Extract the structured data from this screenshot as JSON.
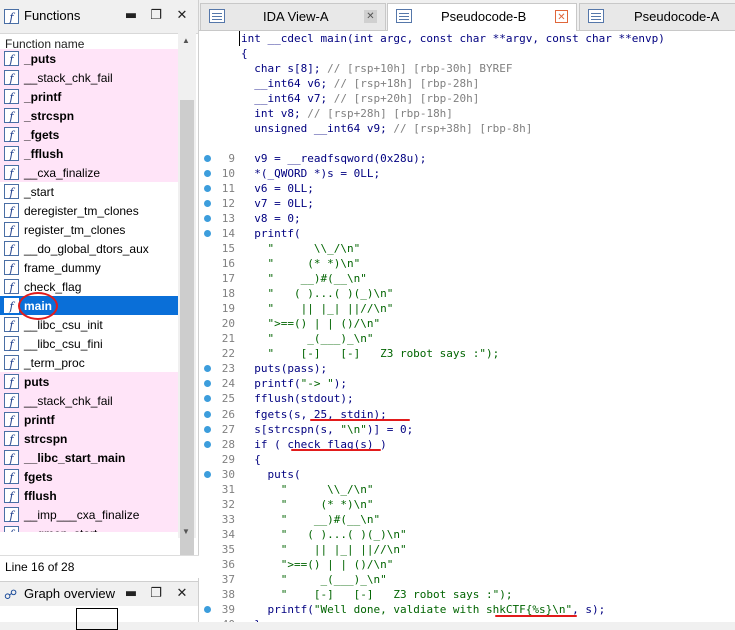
{
  "functions_panel": {
    "title": "Functions",
    "column_header": "Function name",
    "status": "Line 16 of 28",
    "items": [
      {
        "name": "_puts",
        "style": "pink-bold"
      },
      {
        "name": "__stack_chk_fail",
        "style": "pink"
      },
      {
        "name": "_printf",
        "style": "pink-bold"
      },
      {
        "name": "_strcspn",
        "style": "pink-bold"
      },
      {
        "name": "_fgets",
        "style": "pink-bold"
      },
      {
        "name": "_fflush",
        "style": "pink-bold"
      },
      {
        "name": "__cxa_finalize",
        "style": "pink"
      },
      {
        "name": "_start",
        "style": "white"
      },
      {
        "name": "deregister_tm_clones",
        "style": "white"
      },
      {
        "name": "register_tm_clones",
        "style": "white"
      },
      {
        "name": "__do_global_dtors_aux",
        "style": "white"
      },
      {
        "name": "frame_dummy",
        "style": "white"
      },
      {
        "name": "check_flag",
        "style": "white"
      },
      {
        "name": "main",
        "style": "selected"
      },
      {
        "name": "__libc_csu_init",
        "style": "white"
      },
      {
        "name": "__libc_csu_fini",
        "style": "white"
      },
      {
        "name": "_term_proc",
        "style": "white"
      },
      {
        "name": "puts",
        "style": "pink-bold"
      },
      {
        "name": "__stack_chk_fail",
        "style": "pink"
      },
      {
        "name": "printf",
        "style": "pink-bold"
      },
      {
        "name": "strcspn",
        "style": "pink-bold"
      },
      {
        "name": "__libc_start_main",
        "style": "pink-bold"
      },
      {
        "name": "fgets",
        "style": "pink-bold"
      },
      {
        "name": "fflush",
        "style": "pink-bold"
      },
      {
        "name": "__imp___cxa_finalize",
        "style": "pink"
      },
      {
        "name": "__gmon_start__",
        "style": "pink"
      }
    ]
  },
  "graph_panel": {
    "title": "Graph overview"
  },
  "tabs": [
    {
      "label": "IDA View-A",
      "active": false,
      "close": "gray"
    },
    {
      "label": "Pseudocode-B",
      "active": true,
      "close": "red"
    },
    {
      "label": "Pseudocode-A",
      "active": false,
      "close": "none"
    }
  ],
  "code_lines": [
    {
      "num": "",
      "dot": false,
      "segments": [
        [
          "int __cdecl main(int argc, const char **argv, const char **envp)",
          ""
        ]
      ]
    },
    {
      "num": "",
      "dot": false,
      "segments": [
        [
          "{",
          ""
        ]
      ]
    },
    {
      "num": "",
      "dot": false,
      "segments": [
        [
          "  char s[8]; ",
          ""
        ],
        [
          "// [rsp+10h] [rbp-30h] BYREF",
          "cm"
        ]
      ]
    },
    {
      "num": "",
      "dot": false,
      "segments": [
        [
          "  __int64 v6; ",
          ""
        ],
        [
          "// [rsp+18h] [rbp-28h]",
          "cm"
        ]
      ]
    },
    {
      "num": "",
      "dot": false,
      "segments": [
        [
          "  __int64 v7; ",
          ""
        ],
        [
          "// [rsp+20h] [rbp-20h]",
          "cm"
        ]
      ]
    },
    {
      "num": "",
      "dot": false,
      "segments": [
        [
          "  int v8; ",
          ""
        ],
        [
          "// [rsp+28h] [rbp-18h]",
          "cm"
        ]
      ]
    },
    {
      "num": "",
      "dot": false,
      "segments": [
        [
          "  unsigned __int64 v9; ",
          ""
        ],
        [
          "// [rsp+38h] [rbp-8h]",
          "cm"
        ]
      ]
    },
    {
      "num": "",
      "dot": false,
      "segments": [
        [
          "",
          ""
        ]
      ]
    },
    {
      "num": "9",
      "dot": true,
      "segments": [
        [
          "  v9 = __readfsqword(0x28u);",
          ""
        ]
      ]
    },
    {
      "num": "10",
      "dot": true,
      "segments": [
        [
          "  *(_QWORD *)s = 0LL;",
          ""
        ]
      ]
    },
    {
      "num": "11",
      "dot": true,
      "segments": [
        [
          "  v6 = 0LL;",
          ""
        ]
      ]
    },
    {
      "num": "12",
      "dot": true,
      "segments": [
        [
          "  v7 = 0LL;",
          ""
        ]
      ]
    },
    {
      "num": "13",
      "dot": true,
      "segments": [
        [
          "  v8 = 0;",
          ""
        ]
      ]
    },
    {
      "num": "14",
      "dot": true,
      "segments": [
        [
          "  printf(",
          ""
        ]
      ]
    },
    {
      "num": "15",
      "dot": false,
      "segments": [
        [
          "    \"      \\\\_/\\n\"",
          "str"
        ]
      ]
    },
    {
      "num": "16",
      "dot": false,
      "segments": [
        [
          "    \"     (* *)\\n\"",
          "str"
        ]
      ]
    },
    {
      "num": "17",
      "dot": false,
      "segments": [
        [
          "    \"    __)#(__\\n\"",
          "str"
        ]
      ]
    },
    {
      "num": "18",
      "dot": false,
      "segments": [
        [
          "    \"   ( )...( )(_)\\n\"",
          "str"
        ]
      ]
    },
    {
      "num": "19",
      "dot": false,
      "segments": [
        [
          "    \"    || |_| ||//\\n\"",
          "str"
        ]
      ]
    },
    {
      "num": "20",
      "dot": false,
      "segments": [
        [
          "    \">==() | | ()/\\n\"",
          "str"
        ]
      ]
    },
    {
      "num": "21",
      "dot": false,
      "segments": [
        [
          "    \"     _(___)_\\n\"",
          "str"
        ]
      ]
    },
    {
      "num": "22",
      "dot": false,
      "segments": [
        [
          "    \"    [-]   [-]   Z3 robot says :\");",
          "str"
        ]
      ]
    },
    {
      "num": "23",
      "dot": true,
      "segments": [
        [
          "  puts(pass);",
          ""
        ]
      ]
    },
    {
      "num": "24",
      "dot": true,
      "segments": [
        [
          "  printf(",
          ""
        ],
        [
          "\"-> \"",
          "str"
        ],
        [
          ");",
          ""
        ]
      ]
    },
    {
      "num": "25",
      "dot": true,
      "segments": [
        [
          "  fflush(stdout);",
          ""
        ]
      ]
    },
    {
      "num": "26",
      "dot": true,
      "segments": [
        [
          "  fgets(s, 25, stdin);",
          ""
        ]
      ]
    },
    {
      "num": "27",
      "dot": true,
      "segments": [
        [
          "  s[strcspn(s, ",
          ""
        ],
        [
          "\"\\n\"",
          "str"
        ],
        [
          ")] = 0;",
          ""
        ]
      ]
    },
    {
      "num": "28",
      "dot": true,
      "segments": [
        [
          "  if ( check_flag(s) )",
          ""
        ]
      ]
    },
    {
      "num": "29",
      "dot": false,
      "segments": [
        [
          "  {",
          ""
        ]
      ]
    },
    {
      "num": "30",
      "dot": true,
      "segments": [
        [
          "    puts(",
          ""
        ]
      ]
    },
    {
      "num": "31",
      "dot": false,
      "segments": [
        [
          "      \"      \\\\_/\\n\"",
          "str"
        ]
      ]
    },
    {
      "num": "32",
      "dot": false,
      "segments": [
        [
          "      \"     (* *)\\n\"",
          "str"
        ]
      ]
    },
    {
      "num": "33",
      "dot": false,
      "segments": [
        [
          "      \"    __)#(__\\n\"",
          "str"
        ]
      ]
    },
    {
      "num": "34",
      "dot": false,
      "segments": [
        [
          "      \"   ( )...( )(_)\\n\"",
          "str"
        ]
      ]
    },
    {
      "num": "35",
      "dot": false,
      "segments": [
        [
          "      \"    || |_| ||//\\n\"",
          "str"
        ]
      ]
    },
    {
      "num": "36",
      "dot": false,
      "segments": [
        [
          "      \">==() | | ()/\\n\"",
          "str"
        ]
      ]
    },
    {
      "num": "37",
      "dot": false,
      "segments": [
        [
          "      \"     _(___)_\\n\"",
          "str"
        ]
      ]
    },
    {
      "num": "38",
      "dot": false,
      "segments": [
        [
          "      \"    [-]   [-]   Z3 robot says :\");",
          "str"
        ]
      ]
    },
    {
      "num": "39",
      "dot": true,
      "segments": [
        [
          "    printf(",
          ""
        ],
        [
          "\"Well done, valdiate with shkCTF{%s}\\n\"",
          "str"
        ],
        [
          ", s);",
          ""
        ]
      ]
    },
    {
      "num": "40",
      "dot": false,
      "segments": [
        [
          "  }",
          ""
        ]
      ]
    }
  ],
  "colors": {
    "selection": "#0a6fd8",
    "library_bg": "#ffe4f8",
    "annotation_red": "#e21b1b",
    "breakpoint_dot": "#3c9ddc"
  }
}
